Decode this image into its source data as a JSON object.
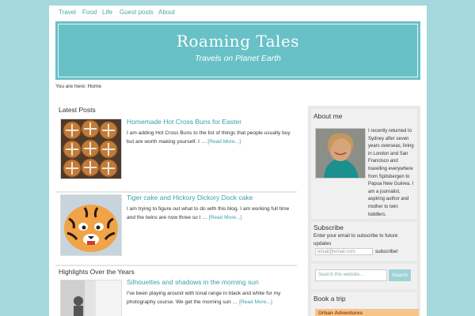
{
  "nav": {
    "items": [
      "Travel",
      "Food",
      "Life",
      "Guest posts",
      "About"
    ]
  },
  "header": {
    "title": "Roaming Tales",
    "description": "Travels on Planet Earth"
  },
  "breadcrumb": "You are here: Home",
  "latest_posts": {
    "title": "Latest Posts",
    "posts": [
      {
        "title": "Homemade Hot Cross Buns for Easter",
        "excerpt": "I am adding Hot Cross Buns to the list of things that people usually buy but are worth making yourself. I …",
        "read_more": "[Read More...]"
      },
      {
        "title": "Tiger cake and Hickory Dickory Dock cake",
        "excerpt": "I am trying to figure out what to do with this blog. I am working full time and the twins are now three so I …",
        "read_more": "[Read More...]"
      }
    ]
  },
  "highlights": {
    "title": "Highlights Over the Years",
    "posts": [
      {
        "title": "Silhouettes and shadows in the morning sun",
        "excerpt": "I've been playing around with tonal range in black and white for my photography course. We get the morning sun …",
        "read_more": "[Read More...]"
      }
    ]
  },
  "sidebar": {
    "about": {
      "title": "About me",
      "text": "I recently returned to Sydney after seven years overseas, living in London and San Francisco and travelling everywhere from Spitsbergen to Papua New Guinea. I am a journalist, aspiring author and mother to twin toddlers."
    },
    "subscribe": {
      "title": "Subscribe",
      "text": "Enter your email to subscribe to future updates",
      "placeholder": "email@email.com",
      "button": "subscribe!"
    },
    "search": {
      "placeholder": "Search this website...",
      "button": "Search"
    },
    "trip": {
      "title": "Book a trip",
      "item": "Urban Adventures"
    }
  }
}
